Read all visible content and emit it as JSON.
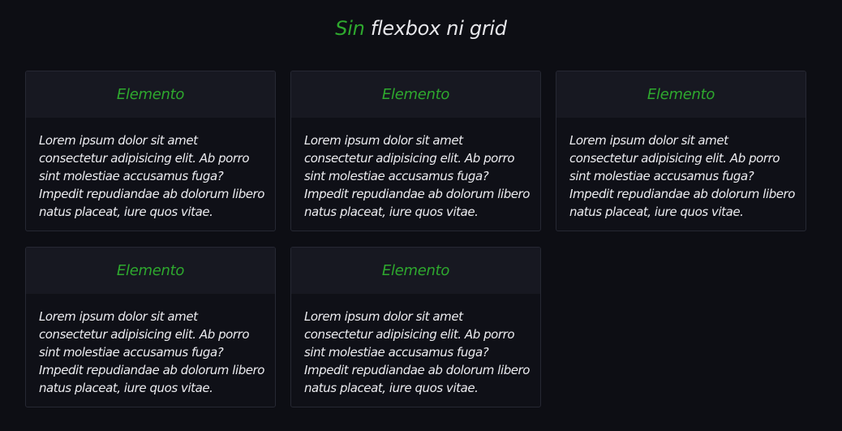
{
  "page_title": {
    "accent": "Sin",
    "rest": " flexbox ni grid"
  },
  "colors": {
    "background": "#0d0e14",
    "card_background": "#0f1017",
    "card_header_background": "#171821",
    "card_border": "#262833",
    "accent": "#2ea82e",
    "text": "#ececf0"
  },
  "cards": [
    {
      "title": "Elemento",
      "body": "Lorem ipsum dolor sit amet consectetur adipisicing elit. Ab porro sint molestiae accusamus fuga? Impedit repudiandae ab dolorum libero natus placeat, iure quos vitae."
    },
    {
      "title": "Elemento",
      "body": "Lorem ipsum dolor sit amet consectetur adipisicing elit. Ab porro sint molestiae accusamus fuga? Impedit repudiandae ab dolorum libero natus placeat, iure quos vitae."
    },
    {
      "title": "Elemento",
      "body": "Lorem ipsum dolor sit amet consectetur adipisicing elit. Ab porro sint molestiae accusamus fuga? Impedit repudiandae ab dolorum libero natus placeat, iure quos vitae."
    },
    {
      "title": "Elemento",
      "body": "Lorem ipsum dolor sit amet consectetur adipisicing elit. Ab porro sint molestiae accusamus fuga? Impedit repudiandae ab dolorum libero natus placeat, iure quos vitae."
    },
    {
      "title": "Elemento",
      "body": "Lorem ipsum dolor sit amet consectetur adipisicing elit. Ab porro sint molestiae accusamus fuga? Impedit repudiandae ab dolorum libero natus placeat, iure quos vitae."
    }
  ]
}
